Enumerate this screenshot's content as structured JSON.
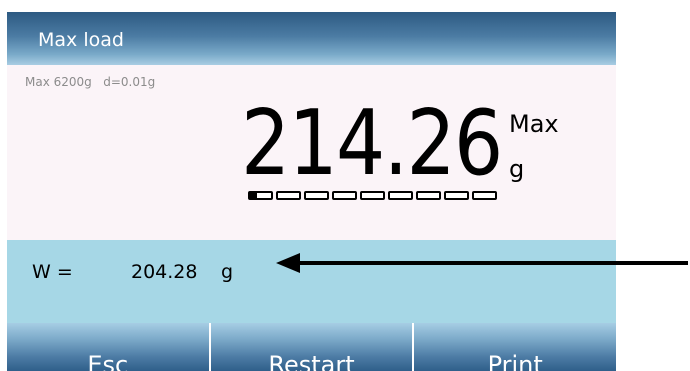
{
  "title_bar": {
    "title": "Max load"
  },
  "weighing": {
    "spec_line": "Max 6200g   d=0.01g",
    "main_value": "214.26",
    "mode_label": "Max",
    "unit": "g",
    "capacity_bar": {
      "segments": 9,
      "filled_fraction": 0.035
    }
  },
  "result": {
    "label": "W =",
    "value": "204.28",
    "unit": "g"
  },
  "soft_buttons": [
    {
      "label": "Esc"
    },
    {
      "label": "Restart"
    },
    {
      "label": "Print"
    }
  ],
  "annotation": {
    "icon": "left-arrow-icon"
  },
  "colors": {
    "title_bar_top": "#2d5a82",
    "result_panel": "#a6d7e6",
    "display_background": "#fbf4f8"
  }
}
